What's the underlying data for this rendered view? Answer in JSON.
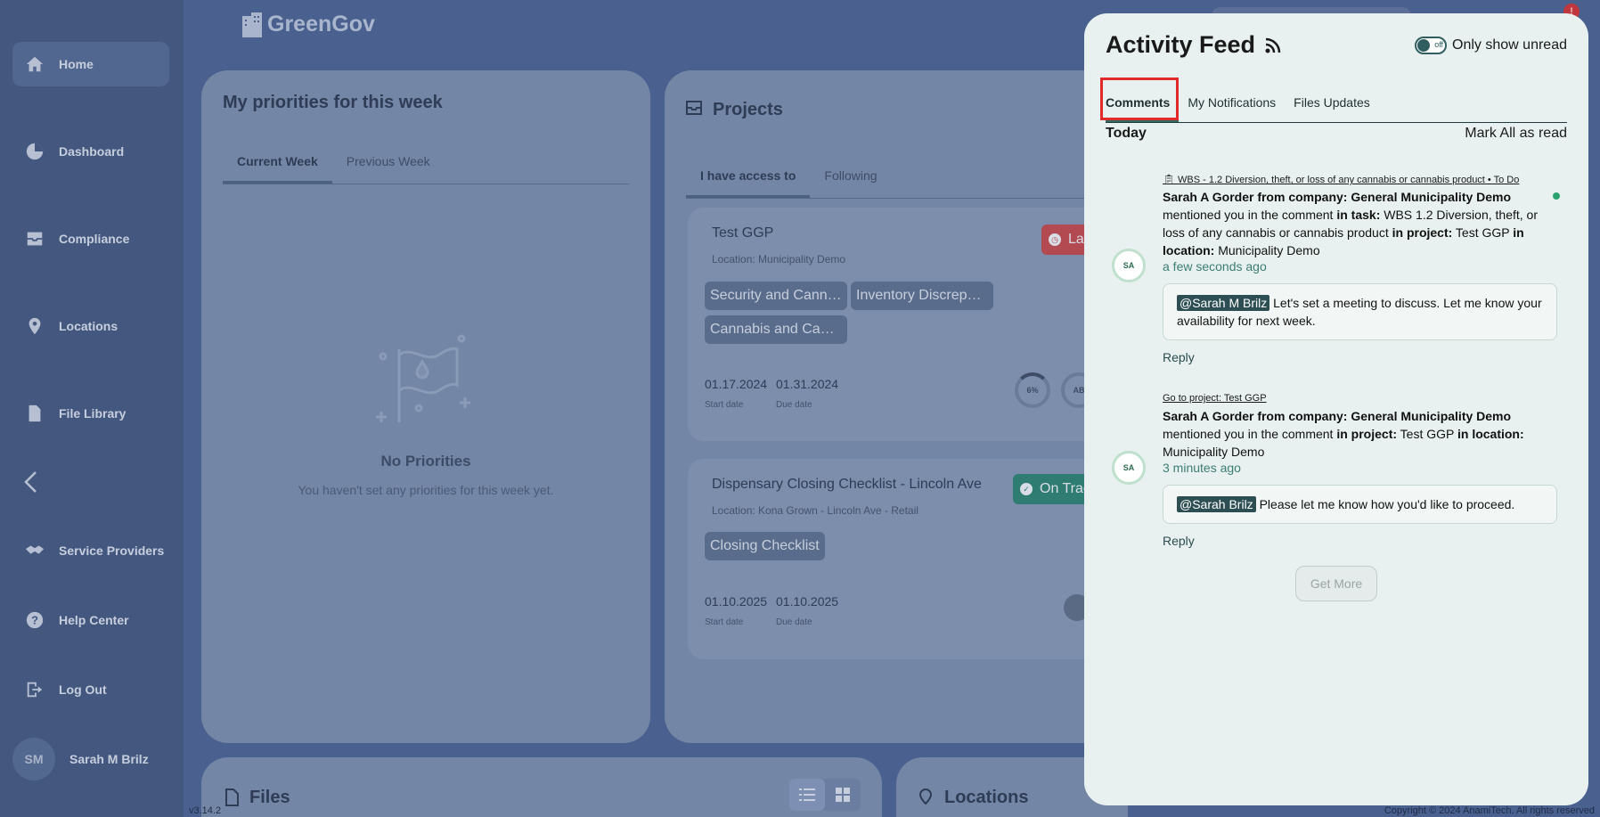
{
  "app": {
    "logo_text": "GreenGov",
    "version": "v3.14.2",
    "copyright": "Copyright © 2024 AnamiTech. All rights reserved"
  },
  "sidebar": {
    "items": [
      {
        "label": "Home",
        "icon": "home-icon"
      },
      {
        "label": "Dashboard",
        "icon": "dashboard-icon"
      },
      {
        "label": "Compliance",
        "icon": "compliance-icon"
      },
      {
        "label": "Locations",
        "icon": "location-pin-icon"
      },
      {
        "label": "File Library",
        "icon": "file-icon"
      },
      {
        "label": "Service Providers",
        "icon": "handshake-icon"
      },
      {
        "label": "Help Center",
        "icon": "help-icon"
      },
      {
        "label": "Log Out",
        "icon": "logout-icon"
      }
    ],
    "user": {
      "initials": "SM",
      "name": "Sarah M Brilz"
    }
  },
  "priorities": {
    "title": "My priorities for this week",
    "tabs": [
      "Current Week",
      "Previous Week"
    ],
    "empty_title": "No Priorities",
    "empty_subtitle": "You haven't set any priorities for this week yet."
  },
  "projects": {
    "title": "Projects",
    "tabs": [
      "I have access to",
      "Following"
    ],
    "items": [
      {
        "name": "Test GGP",
        "location": "Location: Municipality Demo",
        "status": "Late",
        "chips": [
          "Security and Canna…",
          "Inventory Discrepa…",
          "Cannabis and Cann…"
        ],
        "start_date": "01.17.2024",
        "due_date": "01.31.2024",
        "start_label": "Start date",
        "due_label": "Due date",
        "progress_label": "6%",
        "assignee_initials": "AB"
      },
      {
        "name": "Dispensary Closing Checklist - Lincoln Ave",
        "location": "Location: Kona Grown - Lincoln Ave - Retail",
        "status": "On Track",
        "chips": [
          "Closing Checklist"
        ],
        "start_date": "01.10.2025",
        "due_date": "01.10.2025",
        "start_label": "Start date",
        "due_label": "Due date"
      }
    ]
  },
  "files": {
    "title": "Files"
  },
  "locations_card": {
    "title": "Locations"
  },
  "feed": {
    "title": "Activity Feed",
    "toggle_state": "off",
    "toggle_label": "Only show unread",
    "tabs": [
      "Comments",
      "My Notifications",
      "Files Updates"
    ],
    "section": "Today",
    "mark_all": "Mark All as read",
    "get_more": "Get More",
    "entries": [
      {
        "avatar": "SA",
        "link": "WBS - 1.2 Diversion, theft, or loss of any cannabis or cannabis product • To Do",
        "sender": "Sarah A Gorder from company: General Municipality Demo",
        "t1": "mentioned you in the comment",
        "k1": "in task:",
        "v1": "WBS 1.2 Diversion, theft, or loss of any cannabis or cannabis product",
        "k2": "in project:",
        "v2": "Test GGP",
        "k3": "in location:",
        "v3": "Municipality Demo",
        "time": "a few seconds ago",
        "mention": "@Sarah M Brilz",
        "comment": "Let's set a meeting to discuss. Let me know your availability for next week.",
        "reply": "Reply"
      },
      {
        "avatar": "SA",
        "link": "Go to project: Test GGP",
        "sender": "Sarah A Gorder from company: General Municipality Demo",
        "t1": "mentioned you in the comment",
        "k2": "in project:",
        "v2": "Test GGP",
        "k3": "in location:",
        "v3": "Municipality Demo",
        "time": "3 minutes ago",
        "mention": "@Sarah Brilz",
        "comment": "Please let me know how you'd like to proceed.",
        "reply": "Reply"
      }
    ]
  },
  "colors": {
    "accent": "#2f6a63",
    "highlight": "#e12b2b",
    "late": "#c0383e",
    "on_track": "#2f8a78"
  }
}
